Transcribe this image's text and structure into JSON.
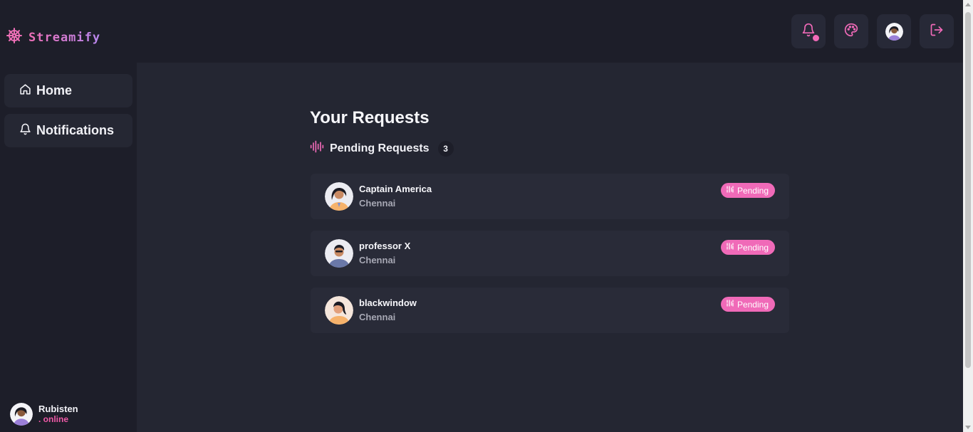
{
  "brand": {
    "name": "Streamify",
    "icon": "ship-wheel-icon"
  },
  "sidebar": {
    "items": [
      {
        "label": "Home",
        "icon": "home-icon"
      },
      {
        "label": "Notifications",
        "icon": "bell-icon"
      }
    ],
    "user": {
      "name": "Rubisten",
      "status": ". online"
    }
  },
  "header": {
    "buttons": [
      "bell-icon",
      "palette-icon",
      "avatar",
      "logout-icon"
    ],
    "has_unread_notifications": true
  },
  "main": {
    "title": "Your Requests",
    "section": {
      "label": "Pending Requests",
      "count": "3",
      "icon": "audio-wave-icon"
    },
    "requests": [
      {
        "name": "Captain America",
        "location": "Chennai",
        "status": "Pending"
      },
      {
        "name": "professor X",
        "location": "Chennai",
        "status": "Pending"
      },
      {
        "name": "blackwindow",
        "location": "Chennai",
        "status": "Pending"
      }
    ]
  },
  "colors": {
    "accent": "#f06ab8",
    "background": "#1d1e29",
    "panel": "#242632",
    "card": "#292b38"
  }
}
